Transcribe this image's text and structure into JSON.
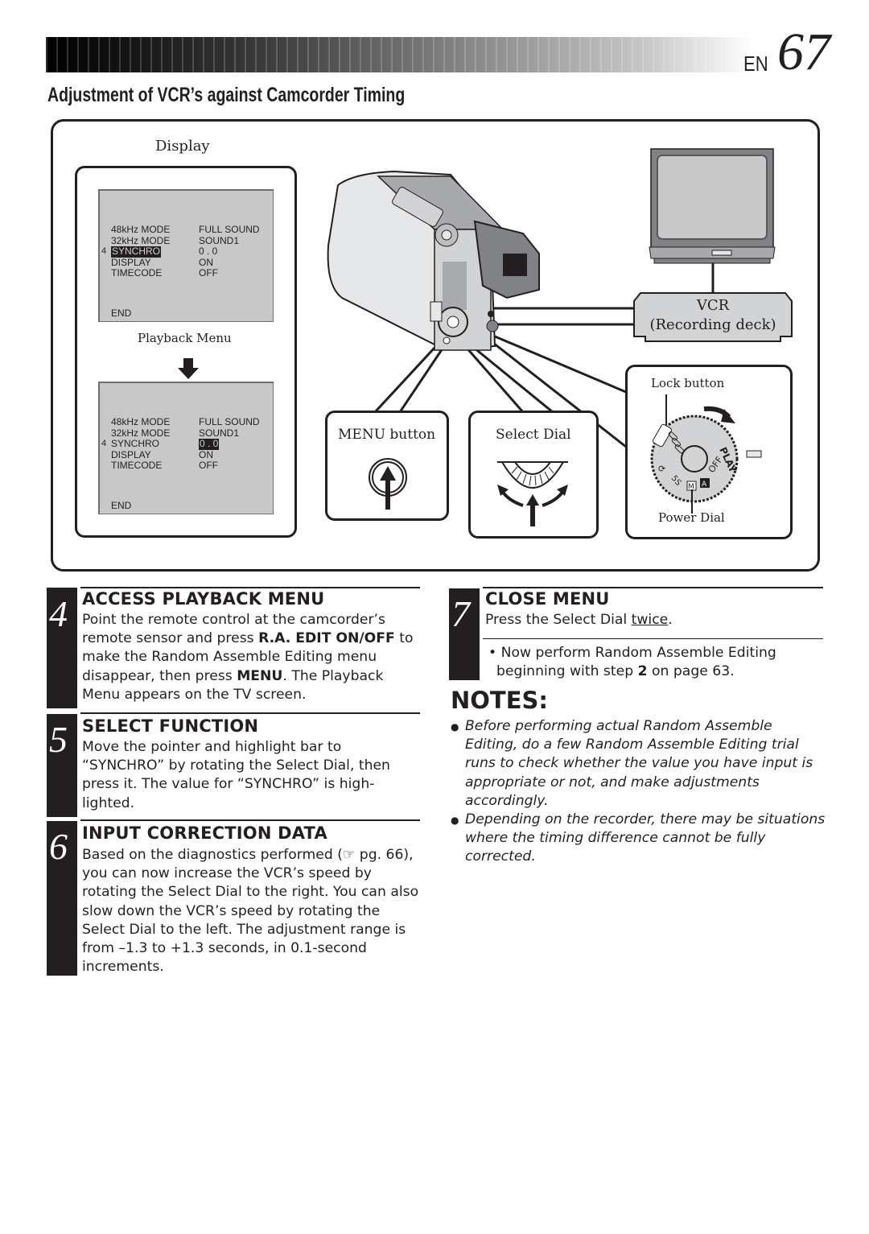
{
  "header": {
    "lang": "EN",
    "page_number": "67",
    "section_title": "Adjustment of VCR’s against Camcorder Timing"
  },
  "diagram": {
    "display_label": "Display",
    "playback_menu_label": "Playback Menu",
    "screen_before": {
      "rows": [
        {
          "key": "48kHz  MODE",
          "value": "FULL SOUND"
        },
        {
          "key": "32kHz  MODE",
          "value": "SOUND1"
        },
        {
          "key": "SYNCHRO",
          "value": "0 . 0"
        },
        {
          "key": "DISPLAY",
          "value": "ON"
        },
        {
          "key": "TIMECODE",
          "value": "OFF"
        }
      ],
      "highlighted": "SYNCHRO",
      "pointer": "4",
      "end": "END"
    },
    "screen_after": {
      "rows": [
        {
          "key": "48kHz  MODE",
          "value": "FULL SOUND"
        },
        {
          "key": "32kHz  MODE",
          "value": "SOUND1"
        },
        {
          "key": "SYNCHRO",
          "value": "0 . 0"
        },
        {
          "key": "DISPLAY",
          "value": "ON"
        },
        {
          "key": "TIMECODE",
          "value": "OFF"
        }
      ],
      "highlighted_value": "0 . 0",
      "pointer": "4",
      "end": "END"
    },
    "vcr_label": "VCR",
    "vcr_sublabel": "(Recording deck)",
    "menu_button_label": "MENU button",
    "select_dial_label": "Select Dial",
    "lock_button_label": "Lock button",
    "power_dial_label": "Power Dial",
    "power_dial_marks": [
      "PLAY",
      "OFF",
      "A",
      "M",
      "5S"
    ]
  },
  "steps": [
    {
      "number": "4",
      "title": "ACCESS PLAYBACK MENU",
      "text_parts": [
        "Point the remote control at the camcorder’s remote sensor and press ",
        "R.A. EDIT ON/OFF",
        " to make the Random Assemble Editing menu disappear, then press ",
        "MENU",
        ". The Playback Menu appears on the TV screen."
      ]
    },
    {
      "number": "5",
      "title": "SELECT FUNCTION",
      "text": "Move the pointer and highlight bar to “SYNCHRO” by rotating the Select Dial, then press it. The value for “SYNCHRO” is high-lighted."
    },
    {
      "number": "6",
      "title": "INPUT CORRECTION DATA",
      "text_parts": [
        "Based on the diagnostics performed (",
        "☞",
        " pg. 66), you can now increase the VCR’s speed by rotating the Select Dial to the right. You can also slow down the VCR’s speed by rotating the Select Dial to the left. The adjustment range is from –1.3 to +1.3 seconds, in 0.1-second increments."
      ]
    },
    {
      "number": "7",
      "title": "CLOSE MENU",
      "text_parts": [
        "Press the Select Dial ",
        "twice",
        "."
      ],
      "bullet_parts": [
        "Now perform Random Assemble Editing beginning with step ",
        "2",
        " on page 63."
      ]
    }
  ],
  "notes": {
    "title": "NOTES:",
    "items": [
      "Before performing actual Random Assemble Editing, do a few Random Assemble Editing trial runs to check whether the value you have input is appropriate or not, and make adjustments accordingly.",
      "Depending on the recorder, there may be situations where the timing difference cannot be fully corrected."
    ]
  }
}
